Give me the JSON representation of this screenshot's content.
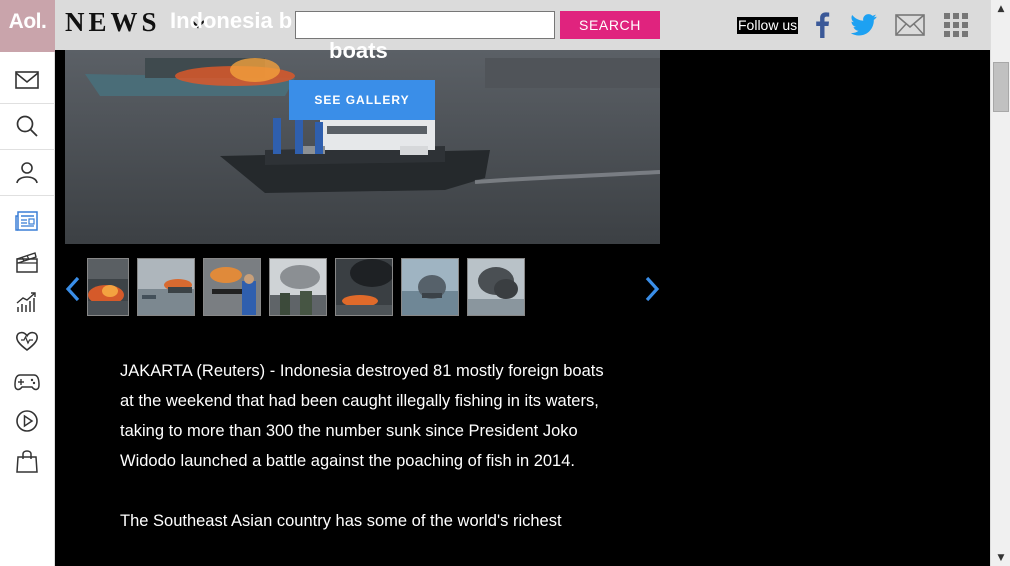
{
  "brand": {
    "logo": "Aol.",
    "section": "NEWS"
  },
  "header": {
    "search_placeholder": "",
    "search_label": "SEARCH",
    "follow_label": "Follow us"
  },
  "social": [
    "facebook-icon",
    "twitter-icon",
    "mail-icon",
    "apps-grid-icon"
  ],
  "sidebar": {
    "items": [
      "mail-icon",
      "search-icon",
      "user-icon",
      "news-icon",
      "entertainment-icon",
      "finance-icon",
      "lifestyle-icon",
      "games-icon",
      "video-icon",
      "shopping-icon"
    ]
  },
  "gallery": {
    "title_line1": "Indonesia b",
    "title_line2": "boats",
    "see_gallery_label": "SEE GALLERY",
    "thumbnail_count": 7
  },
  "article": {
    "paragraphs": [
      "JAKARTA (Reuters) - Indonesia destroyed 81 mostly foreign boats at the weekend that had been caught illegally fishing in its waters, taking to more than 300 the number sunk since President Joko Widodo launched a battle against the poaching of fish in 2014.",
      "The Southeast Asian country has some of the world's richest"
    ]
  },
  "colors": {
    "accent_pink": "#e0237e",
    "gallery_blue": "#3a8ee8",
    "icon_blue": "#3b7fd6",
    "facebook": "#3b5998",
    "twitter": "#1da1f2"
  }
}
